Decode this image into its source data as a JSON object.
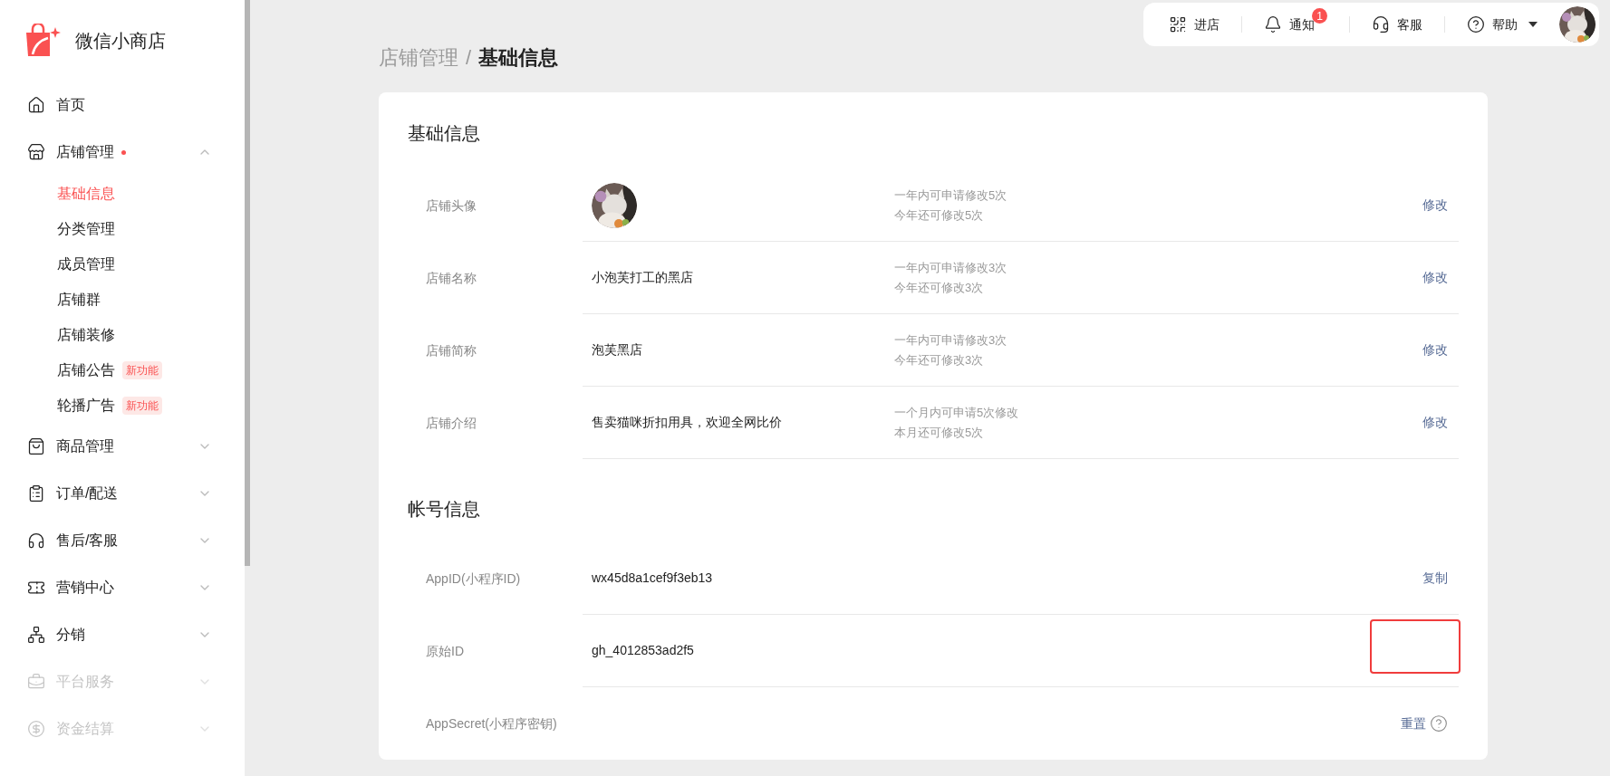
{
  "brand": {
    "name": "微信小商店"
  },
  "sidebar": {
    "items": [
      {
        "label": "首页"
      },
      {
        "label": "店铺管理",
        "expanded": true,
        "has_dot": true,
        "has_arrow": true,
        "children": [
          {
            "label": "基础信息",
            "selected": true
          },
          {
            "label": "分类管理",
            "selected": false
          },
          {
            "label": "成员管理",
            "selected": false
          },
          {
            "label": "店铺群",
            "selected": false
          },
          {
            "label": "店铺装修",
            "selected": false
          },
          {
            "label": "店铺公告",
            "selected": false,
            "badge": "新功能"
          },
          {
            "label": "轮播广告",
            "selected": false,
            "badge": "新功能"
          }
        ]
      },
      {
        "label": "商品管理",
        "expanded": false,
        "has_arrow": true
      },
      {
        "label": "订单/配送",
        "expanded": false,
        "has_arrow": true
      },
      {
        "label": "售后/客服",
        "expanded": false,
        "has_arrow": true
      },
      {
        "label": "营销中心",
        "expanded": false,
        "has_arrow": true
      },
      {
        "label": "分销",
        "expanded": false,
        "has_arrow": true
      },
      {
        "label": "平台服务",
        "expanded": false,
        "disabled": true,
        "has_arrow": true
      },
      {
        "label": "资金结算",
        "expanded": false,
        "disabled": true,
        "has_arrow": true
      }
    ]
  },
  "breadcrumb": {
    "parent": "店铺管理",
    "separator": "/",
    "current": "基础信息"
  },
  "topbar": {
    "items": [
      {
        "label": "进店"
      },
      {
        "label": "通知",
        "badge": "1"
      },
      {
        "label": "客服"
      },
      {
        "label": "帮助"
      }
    ]
  },
  "basic_info": {
    "title": "基础信息",
    "rows": [
      {
        "kind": "avatar",
        "label": "店铺头像",
        "notes": [
          "一年内可申请修改5次",
          "今年还可修改5次"
        ],
        "action": "修改"
      },
      {
        "kind": "text",
        "label": "店铺名称",
        "value": "小泡芙打工的黑店",
        "notes": [
          "一年内可申请修改3次",
          "今年还可修改3次"
        ],
        "action": "修改"
      },
      {
        "kind": "text",
        "label": "店铺简称",
        "value": "泡芙黑店",
        "notes": [
          "一年内可申请修改3次",
          "今年还可修改3次"
        ],
        "action": "修改"
      },
      {
        "kind": "text",
        "label": "店铺介绍",
        "value": "售卖猫咪折扣用具，欢迎全网比价",
        "notes": [
          "一个月内可申请5次修改",
          "本月还可修改5次"
        ],
        "action": "修改"
      }
    ]
  },
  "account_info": {
    "title": "帐号信息",
    "rows": [
      {
        "label": "AppID(小程序ID)",
        "value": "wx45d8a1cef9f3eb13",
        "action": "复制"
      },
      {
        "label": "原始ID",
        "value": "gh_4012853ad2f5",
        "highlighted": true
      },
      {
        "label": "AppSecret(小程序密钥)",
        "action": "重置",
        "help": true
      }
    ]
  }
}
